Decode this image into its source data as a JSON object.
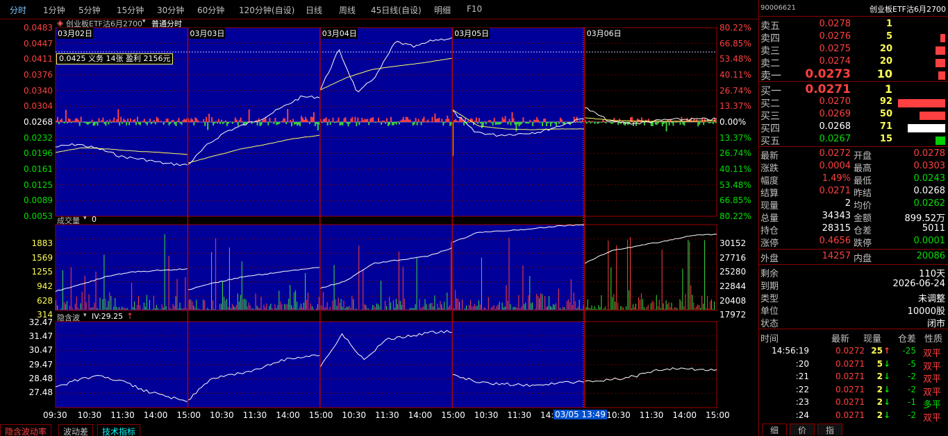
{
  "top_tabs": [
    "分时",
    "1分钟",
    "5分钟",
    "15分钟",
    "30分钟",
    "60分钟",
    "120分钟(自设)",
    "日线",
    "周线",
    "45日线(自设)",
    "明细",
    "F10"
  ],
  "main_chart": {
    "contract": "创业板ETF沽6月2700",
    "mode": "普通分时",
    "dates": [
      "03月02日",
      "03月03日",
      "03月04日",
      "03月05日",
      "03月06日"
    ],
    "price_ticks": [
      "0.0483",
      "0.0447",
      "0.0411",
      "0.0376",
      "0.0340",
      "0.0304",
      "0.0268",
      "0.0232",
      "0.0196",
      "0.0161",
      "0.0125",
      "0.0089",
      "0.0053"
    ],
    "pct_ticks": [
      "80.22%",
      "66.85%",
      "53.48%",
      "40.11%",
      "26.74%",
      "13.37%",
      "0.00%",
      "13.37%",
      "26.74%",
      "40.11%",
      "53.48%",
      "66.85%",
      "80.22%"
    ],
    "info_box": "0.0425 义务  14张 盈利 2156元"
  },
  "volume_chart": {
    "title": "成交量",
    "value": "0",
    "left_ticks": [
      "1883",
      "1569",
      "1255",
      "942",
      "628",
      "314"
    ],
    "right_ticks": [
      "30152",
      "27716",
      "25280",
      "22844",
      "20408",
      "17972"
    ]
  },
  "iv_chart": {
    "title": "隐含波",
    "iv": "IV:29.25",
    "arrow": "↑",
    "ticks": [
      "32.47",
      "31.47",
      "30.47",
      "29.47",
      "28.48",
      "27.48"
    ]
  },
  "time_axis": [
    "09:30",
    "10:30",
    "11:30",
    "14:00",
    "15:00",
    "10:30",
    "11:30",
    "14:00",
    "15:00",
    "10:30",
    "11:30",
    "14:00",
    "15:00",
    "10:30",
    "11:30",
    "14:00",
    "15:00",
    "10:30",
    "11:30",
    "14:00",
    "15:00"
  ],
  "cursor_label": "03/05 13:49",
  "bottom_tabs": [
    "隐含波动率",
    "波动差",
    "技术指标"
  ],
  "quote": {
    "code": "90006621",
    "name": "创业板ETF沽6月2700",
    "asks": [
      {
        "label": "卖五",
        "price": "0.0278",
        "vol": "1",
        "bar": 0
      },
      {
        "label": "卖四",
        "price": "0.0276",
        "vol": "5",
        "bar": 0.1
      },
      {
        "label": "卖三",
        "price": "0.0275",
        "vol": "20",
        "bar": 0.2
      },
      {
        "label": "卖二",
        "price": "0.0274",
        "vol": "20",
        "bar": 0.2
      },
      {
        "label": "卖一",
        "price": "0.0273",
        "vol": "10",
        "bar": 0.15
      }
    ],
    "bids": [
      {
        "label": "买一",
        "price": "0.0271",
        "vol": "1",
        "bar": 0
      },
      {
        "label": "买二",
        "price": "0.0270",
        "vol": "92",
        "bar": 1.0
      },
      {
        "label": "买三",
        "price": "0.0269",
        "vol": "50",
        "bar": 0.55
      },
      {
        "label": "买四",
        "price": "0.0268",
        "vol": "71",
        "bar": 0.8
      },
      {
        "label": "买五",
        "price": "0.0267",
        "vol": "15",
        "bar": 0.2
      }
    ],
    "stats": [
      {
        "l1": "最新",
        "v1": "0.0272",
        "c1": "red",
        "l2": "开盘",
        "v2": "0.0278",
        "c2": "red"
      },
      {
        "l1": "涨跌",
        "v1": "0.0004",
        "c1": "red",
        "l2": "最高",
        "v2": "0.0303",
        "c2": "red"
      },
      {
        "l1": "幅度",
        "v1": "1.49%",
        "c1": "red",
        "l2": "最低",
        "v2": "0.0243",
        "c2": "grn"
      },
      {
        "l1": "结算",
        "v1": "0.0271",
        "c1": "red",
        "l2": "昨结",
        "v2": "0.0268",
        "c2": "wht"
      },
      {
        "l1": "现量",
        "v1": "2",
        "c1": "wht",
        "l2": "均价",
        "v2": "0.0262",
        "c2": "grn"
      },
      {
        "l1": "总量",
        "v1": "34343",
        "c1": "wht",
        "l2": "金额",
        "v2": "899.52万",
        "c2": "wht"
      },
      {
        "l1": "持仓",
        "v1": "28315",
        "c1": "wht",
        "l2": "仓差",
        "v2": "5011",
        "c2": "wht"
      },
      {
        "l1": "涨停",
        "v1": "0.4656",
        "c1": "red",
        "l2": "跌停",
        "v2": "0.0001",
        "c2": "grn"
      }
    ],
    "outer": {
      "l1": "外盘",
      "v1": "14257",
      "l2": "内盘",
      "v2": "20086"
    },
    "info": [
      {
        "label": "剩余",
        "value": "110天"
      },
      {
        "label": "到期",
        "value": "2026-06-24"
      },
      {
        "label": "类型",
        "value": "未调整"
      },
      {
        "label": "单位",
        "value": "10000股"
      },
      {
        "label": "状态",
        "value": "闭市"
      }
    ],
    "trade_header": [
      "时间",
      "最新",
      "现量",
      "仓差",
      "性质"
    ],
    "trades": [
      {
        "time": "14:56:19",
        "price": "0.0272",
        "vol": "25",
        "arrow": "↑",
        "diff": "-25",
        "nature": "双平",
        "vc": "red",
        "nc": "red"
      },
      {
        "time": ":20",
        "price": "0.0271",
        "vol": "5",
        "arrow": "↓",
        "diff": "-5",
        "nature": "双平",
        "vc": "grn",
        "nc": "red"
      },
      {
        "time": ":21",
        "price": "0.0271",
        "vol": "2",
        "arrow": "↓",
        "diff": "-2",
        "nature": "双平",
        "vc": "grn",
        "nc": "red"
      },
      {
        "time": ":22",
        "price": "0.0271",
        "vol": "2",
        "arrow": "↓",
        "diff": "-2",
        "nature": "双平",
        "vc": "grn",
        "nc": "red"
      },
      {
        "time": ":23",
        "price": "0.0271",
        "vol": "2",
        "arrow": "↓",
        "diff": "-1",
        "nature": "多平",
        "vc": "grn",
        "nc": "grn"
      },
      {
        "time": ":24",
        "price": "0.0271",
        "vol": "2",
        "arrow": "↓",
        "diff": "-2",
        "nature": "双平",
        "vc": "grn",
        "nc": "red"
      }
    ],
    "side_tabs": [
      "细",
      "价",
      "指"
    ]
  }
}
